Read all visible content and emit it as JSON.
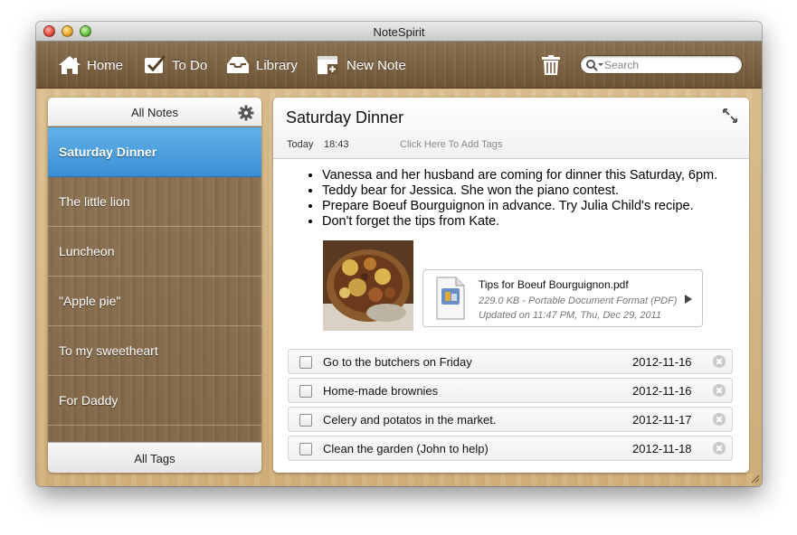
{
  "window": {
    "title": "NoteSpirit"
  },
  "toolbar": {
    "home_label": "Home",
    "todo_label": "To Do",
    "library_label": "Library",
    "new_note_label": "New Note",
    "search_placeholder": "Search"
  },
  "sidebar": {
    "header_label": "All Notes",
    "footer_label": "All Tags",
    "notes": [
      {
        "label": "Saturday Dinner",
        "selected": true
      },
      {
        "label": "The little lion",
        "selected": false
      },
      {
        "label": "Luncheon",
        "selected": false
      },
      {
        "label": "\"Apple pie\"",
        "selected": false
      },
      {
        "label": "To my sweetheart",
        "selected": false
      },
      {
        "label": "For Daddy",
        "selected": false
      }
    ]
  },
  "note": {
    "title": "Saturday Dinner",
    "day": "Today",
    "time": "18:43",
    "tags_prompt": "Click Here To Add Tags",
    "bullets": [
      "Vanessa and her husband are coming for dinner this Saturday, 6pm.",
      "Teddy bear for Jessica. She won the piano contest.",
      "Prepare Boeuf Bourguignon in advance. Try Julia Child's recipe.",
      "Don't forget the tips from Kate."
    ],
    "attachment": {
      "name": "Tips for Boeuf Bourguignon.pdf",
      "meta": "229.0 KB - Portable Document Format (PDF)",
      "updated": "Updated on 11:47 PM, Thu, Dec 29, 2011",
      "icon_label": "PDF"
    },
    "todos": [
      {
        "text": "Go to the butchers on Friday",
        "date": "2012-11-16"
      },
      {
        "text": "Home-made brownies",
        "date": "2012-11-16"
      },
      {
        "text": "Celery and potatos in the market.",
        "date": "2012-11-17"
      },
      {
        "text": "Clean the garden (John to help)",
        "date": "2012-11-18"
      }
    ]
  },
  "colors": {
    "toolbar_wood": "#7a603f",
    "desk_wood": "#d8b98b",
    "selection_blue": "#4a9ddd"
  }
}
